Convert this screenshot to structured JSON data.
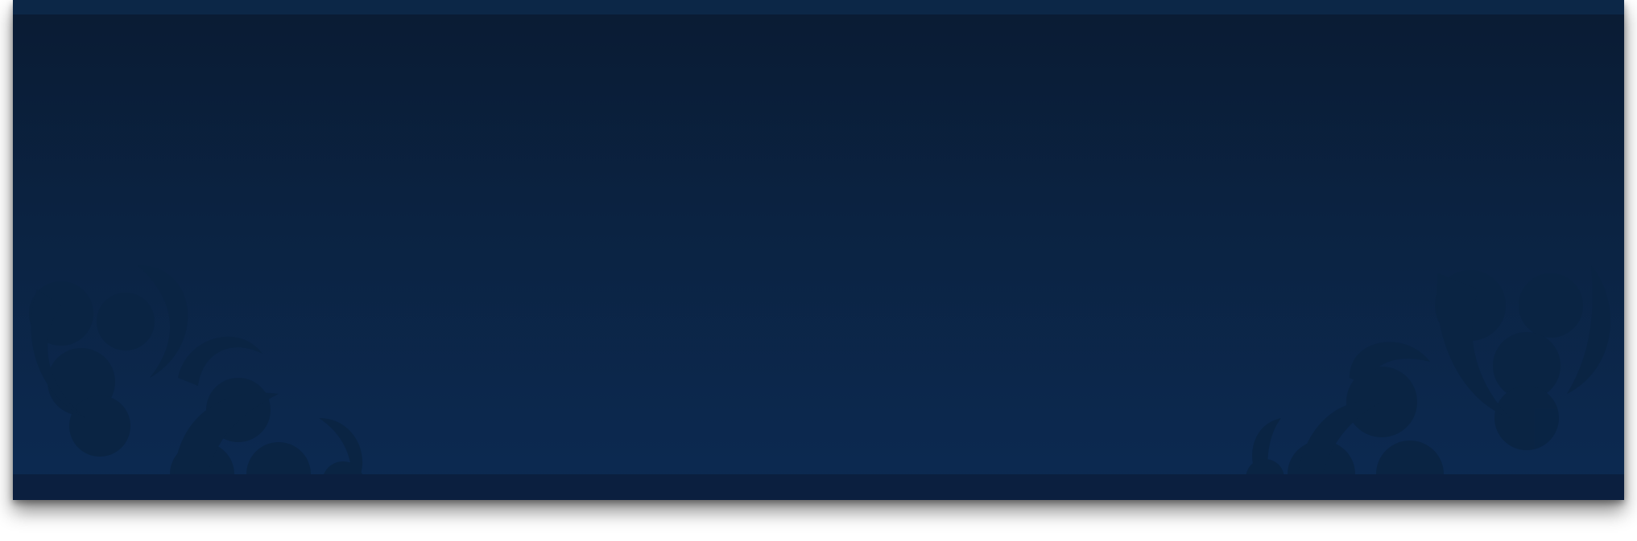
{
  "banner": {
    "background_top": "#0a1b33",
    "background_bottom": "#0c2a52",
    "footer_strip_color": "#0b1f3f",
    "ornament_color": "#0b2644",
    "ornaments": [
      "left-swirl-ornament",
      "right-swirl-ornament"
    ]
  }
}
